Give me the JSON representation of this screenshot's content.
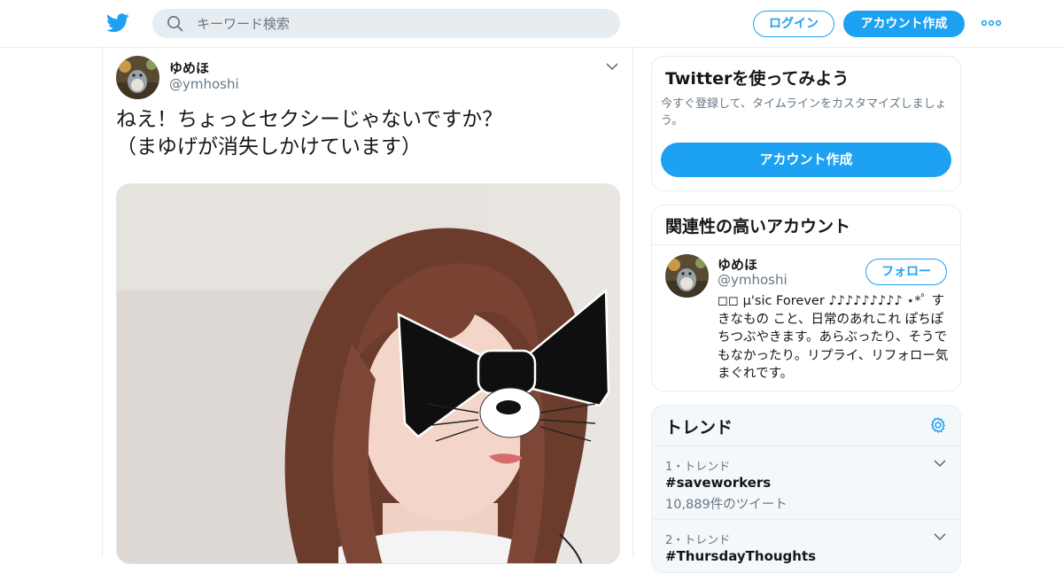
{
  "header": {
    "search_placeholder": "キーワード検索",
    "login_label": "ログイン",
    "signup_label": "アカウント作成",
    "brand_color": "#1da1f2",
    "icons": [
      "twitter-bird-icon",
      "search-icon",
      "more-dots-icon"
    ]
  },
  "tweet": {
    "author_name": "ゆめほ",
    "author_handle": "@ymhoshi",
    "text_line1": "ねえ！ちょっとセクシーじゃないですか？",
    "text_line2": "（まゆげが消失しかけています）",
    "icons": [
      "avatar",
      "chevron-down-icon",
      "photo"
    ]
  },
  "signup_card": {
    "title": "Twitterを使ってみよう",
    "description": "今すぐ登録して、タイムラインをカスタマイズしましょう。",
    "button_label": "アカウント作成"
  },
  "related": {
    "title": "関連性の高いアカウント",
    "name": "ゆめほ",
    "handle": "@ymhoshi",
    "follow_label": "フォロー",
    "bio": "◻◻ µ'sic Forever ♪♪♪♪♪♪♪♪♪ ⋆*ﾟ すきなもの こと、日常のあれこれ ぽちぽちつぶやきます。あらぶったり、そうでもなかったり。リプライ、リフォロー気まぐれです。"
  },
  "trends": {
    "title": "トレンド",
    "items": [
      {
        "meta": "1・トレンド",
        "tag": "#saveworkers",
        "count": "10,889件のツイート"
      },
      {
        "meta": "2・トレンド",
        "tag": "#ThursdayThoughts",
        "count": ""
      }
    ]
  }
}
